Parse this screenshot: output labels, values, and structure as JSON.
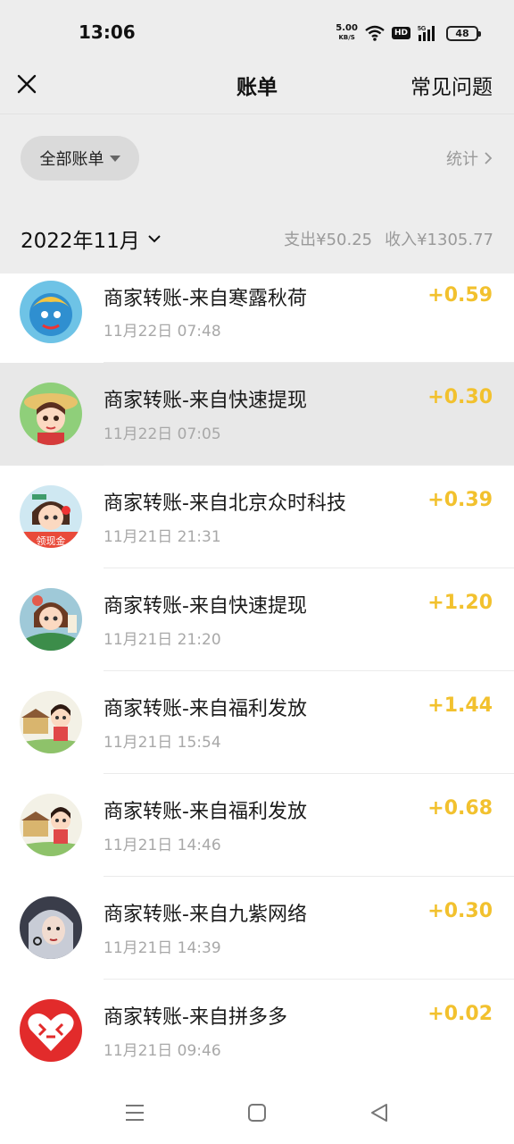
{
  "status": {
    "time": "13:06",
    "net_speed": "5.00",
    "net_unit": "KB/S",
    "hd": "HD",
    "signal": "5G",
    "battery": "48"
  },
  "nav": {
    "title": "账单",
    "faq": "常见问题"
  },
  "filter": {
    "label": "全部账单",
    "stats": "统计"
  },
  "month": {
    "label": "2022年11月",
    "expense": "支出¥50.25",
    "income": "收入¥1305.77"
  },
  "colors": {
    "amount": "#f2c12e",
    "background": "#ededed"
  },
  "transactions": [
    {
      "title": "商家转账-来自寒露秋荷",
      "time": "11月22日 07:48",
      "amount": "+0.59",
      "avatar": "dragon-avatar"
    },
    {
      "title": "商家转账-来自快速提现",
      "time": "11月22日 07:05",
      "amount": "+0.30",
      "avatar": "girl-hat-avatar"
    },
    {
      "title": "商家转账-来自北京众时科技",
      "time": "11月21日 21:31",
      "amount": "+0.39",
      "avatar": "cash-girl-avatar",
      "badge": "领现金"
    },
    {
      "title": "商家转账-来自快速提现",
      "time": "11月21日 21:20",
      "amount": "+1.20",
      "avatar": "ancient-girl-avatar"
    },
    {
      "title": "商家转账-来自福利发放",
      "time": "11月21日 15:54",
      "amount": "+1.44",
      "avatar": "farm-girl-avatar"
    },
    {
      "title": "商家转账-来自福利发放",
      "time": "11月21日 14:46",
      "amount": "+0.68",
      "avatar": "farm-girl-avatar"
    },
    {
      "title": "商家转账-来自九紫网络",
      "time": "11月21日 14:39",
      "amount": "+0.30",
      "avatar": "warrior-avatar"
    },
    {
      "title": "商家转账-来自拼多多",
      "time": "11月21日 09:46",
      "amount": "+0.02",
      "avatar": "pinduoduo-logo-avatar"
    }
  ]
}
